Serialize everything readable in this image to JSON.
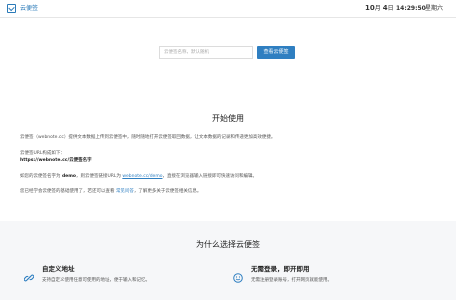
{
  "header": {
    "app_title": "云便签",
    "month": "10",
    "month_unit": "月",
    "day": "4",
    "day_unit": "日",
    "time": "14:29:50",
    "weekday": "星期六"
  },
  "search": {
    "placeholder": "云便签名称，默认随机",
    "button_label": "查看云便签"
  },
  "intro": {
    "title": "开始使用",
    "line1": "云便签（webnote.cc）提供文本数据上传到云便签中，随时随地打开云便签取回数据，让文本数据的记录和传递更加高效便捷。",
    "line2": "云便签URL构成如下：",
    "line3": "https://webnote.cc/云便签名字",
    "line4_pre": "如您的云便签名字为 ",
    "line4_name": "demo",
    "line4_mid": "，则云便签链接URL为 ",
    "line4_link": "webnote.cc/demo",
    "line4_post": "，直接在浏览器输入链接即可快速访问和编辑。",
    "line5_pre": "您已经学会云便签的基础使用了，若还可以查看 ",
    "line5_link": "常见问答",
    "line5_post": "，了解更多关于云便签相关信息。"
  },
  "why": {
    "title": "为什么选择云便签",
    "features": [
      {
        "icon": "link-icon",
        "title": "自定义地址",
        "desc": "支持自定义使用任意可使用的地址，便于输入和记忆。"
      },
      {
        "icon": "smiley-icon",
        "title": "无需登录，即开即用",
        "desc": "无需注册登录账号，打开网页就能使用。"
      }
    ]
  },
  "colors": {
    "accent": "#2f7fc1",
    "section_bg": "#f6f7f9"
  }
}
